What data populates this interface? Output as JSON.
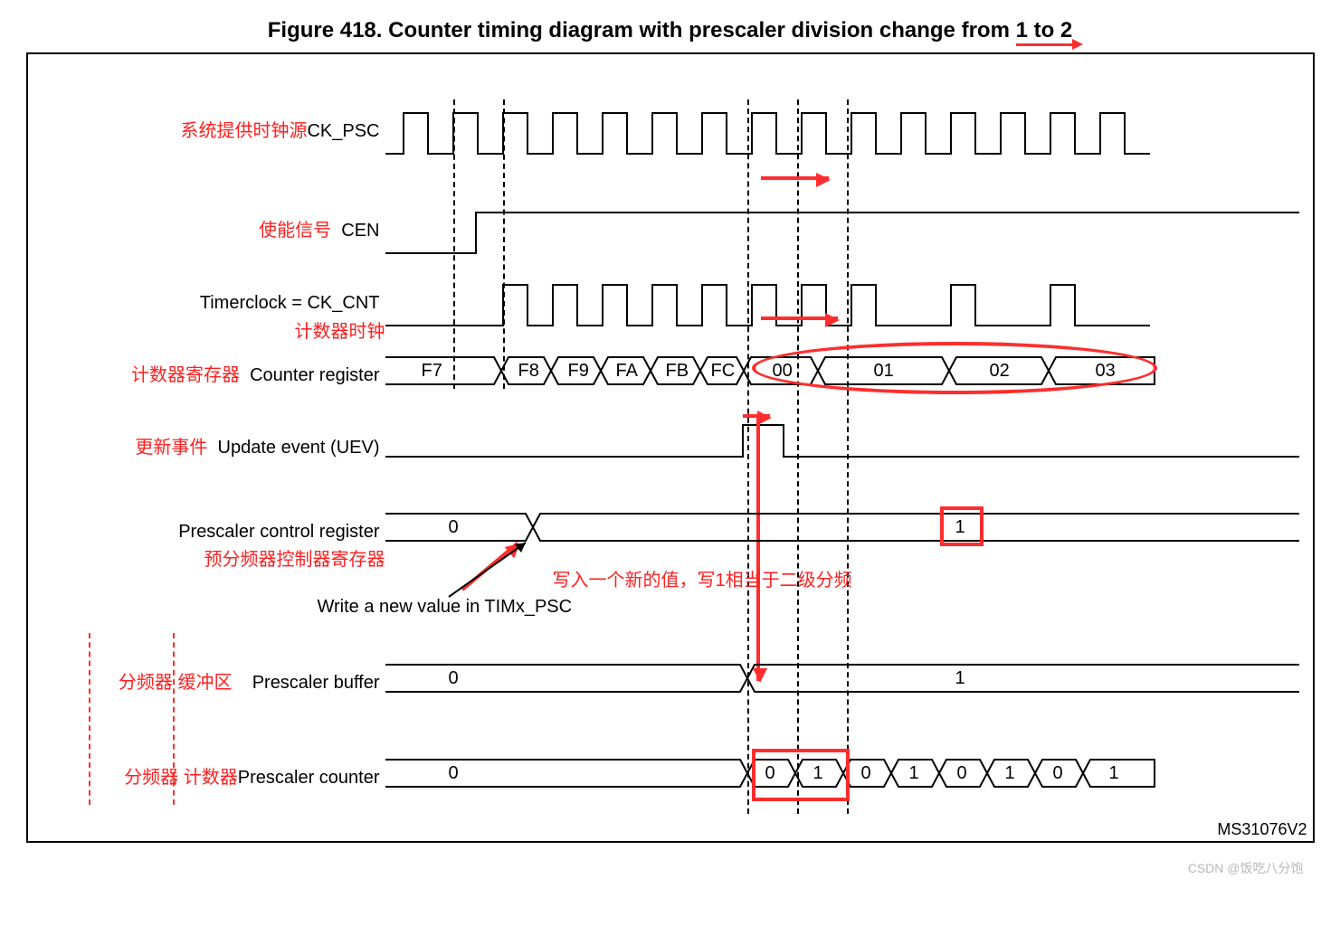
{
  "title_prefix": "Figure 418. Counter timing diagram with prescaler division change from ",
  "title_highlight": "1 to 2",
  "rows": {
    "ck_psc": {
      "red": "系统提供时钟源",
      "label": "CK_PSC"
    },
    "cen": {
      "red": "使能信号",
      "label": "CEN"
    },
    "ck_cnt": {
      "label": "Timerclock = CK_CNT",
      "red_below": "计数器时钟"
    },
    "counter": {
      "red": "计数器寄存器",
      "label": "Counter register",
      "values": [
        "F7",
        "F8",
        "F9",
        "FA",
        "FB",
        "FC",
        "00",
        "01",
        "02",
        "03"
      ]
    },
    "uev": {
      "red": "更新事件",
      "label": "Update event (UEV)"
    },
    "psc_ctrl": {
      "label": "Prescaler control register",
      "red_below": "预分频器控制器寄存器",
      "left_val": "0",
      "right_val": "1"
    },
    "write_note": "Write a new value in TIMx_PSC",
    "psc_buf": {
      "red": "分频器",
      "red2": "缓冲区",
      "label": "Prescaler buffer",
      "left_val": "0",
      "right_val": "1"
    },
    "psc_cnt": {
      "red": "分频器",
      "red2": "计数器",
      "label": "Prescaler counter",
      "left_val": "0",
      "seq": [
        "0",
        "1",
        "0",
        "1",
        "0",
        "1",
        "0",
        "1"
      ]
    }
  },
  "annotations": {
    "middle_red_text": "写入一个新的值，写1相当于二级分频"
  },
  "footnote": "MS31076V2",
  "watermark": "CSDN @饭吃八分饱"
}
